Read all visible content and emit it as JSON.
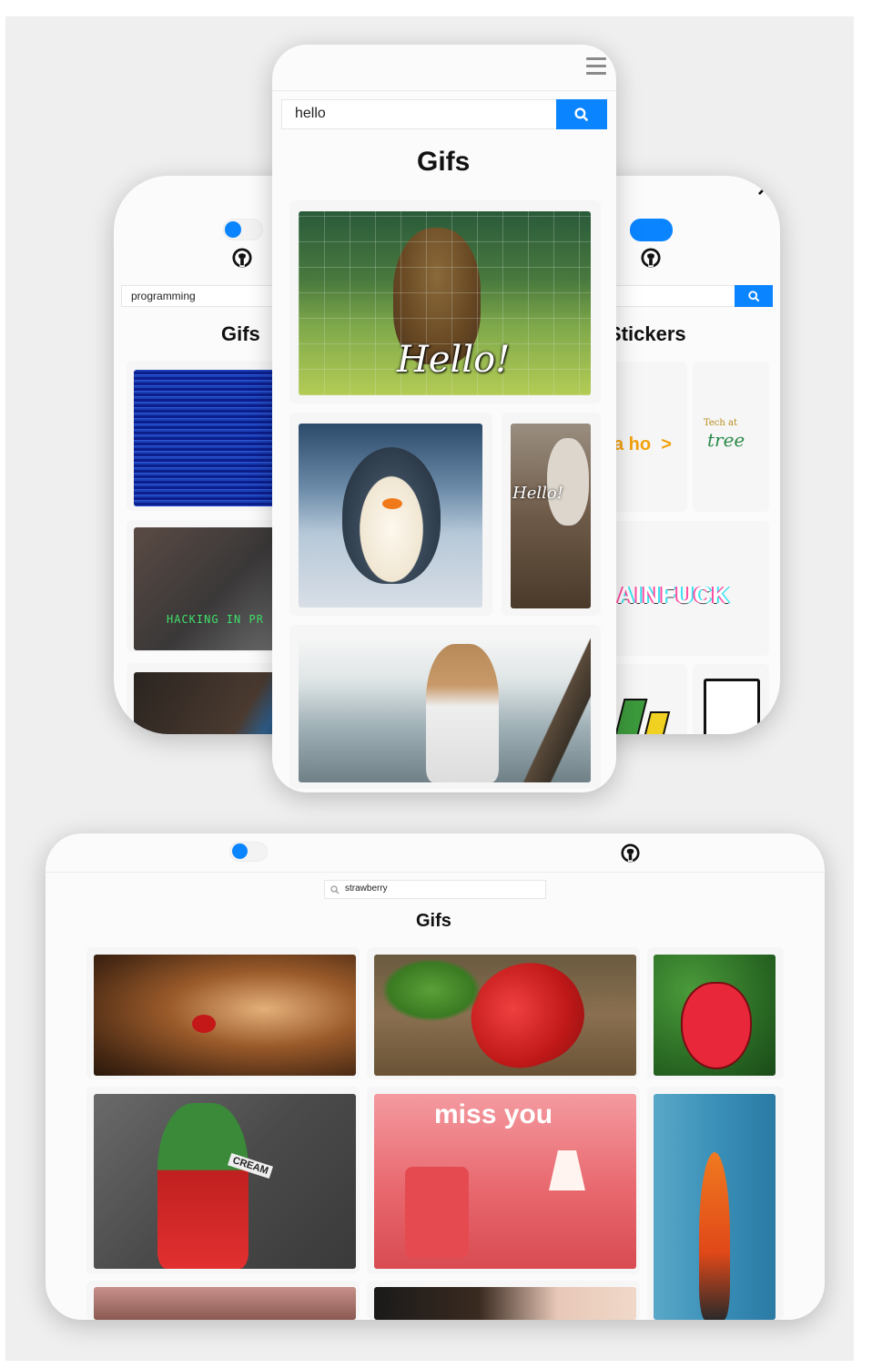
{
  "left_phone": {
    "search_value": "programming",
    "section_title": "Gifs",
    "overlay_text": "HACKING IN PR"
  },
  "center_phone": {
    "search_value": "hello",
    "section_title": "Gifs",
    "bear_caption": "Hello!",
    "mask_caption": "Hello!"
  },
  "right_phone": {
    "close_label": "×",
    "section_title": "Stickers",
    "sticker_text_1": "a ho  >",
    "sticker_text_2": "Tech at",
    "sticker_text_3": "tree",
    "sticker_text_4": "AINFUCK"
  },
  "tablet": {
    "search_value": "strawberry",
    "section_title": "Gifs",
    "caption_cream": "CREAM",
    "caption_miss": "miss you"
  },
  "colors": {
    "accent": "#0a84ff",
    "background": "#efefef",
    "surface": "#fbfbfb"
  },
  "icons": {
    "github": "github-icon",
    "search": "search-icon",
    "menu": "hamburger-menu-icon",
    "close": "close-icon"
  }
}
